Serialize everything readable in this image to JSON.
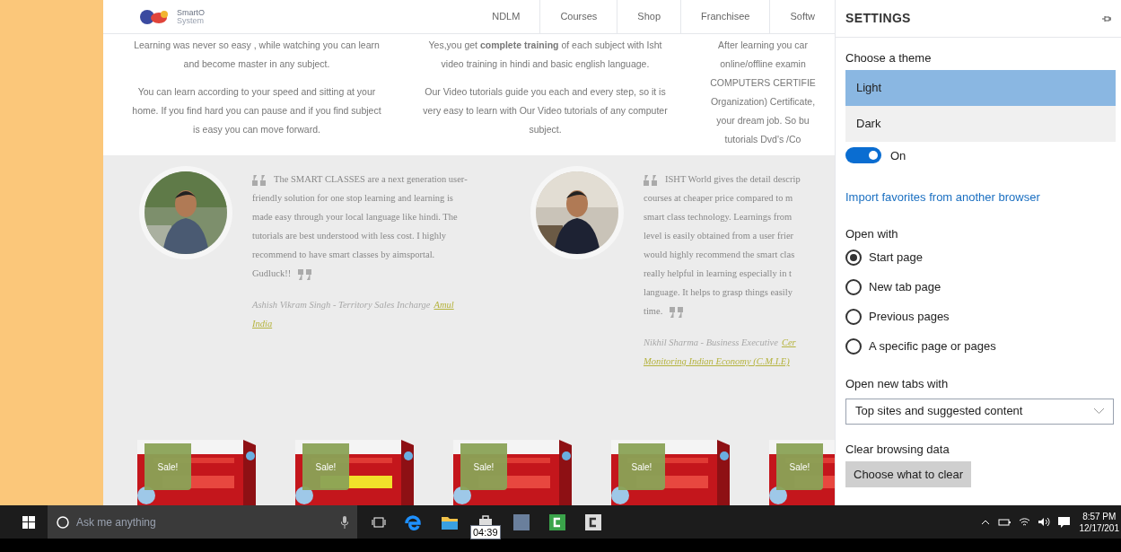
{
  "site": {
    "logo_text": "SmartO",
    "logo_sub": "System",
    "nav": [
      {
        "label": "NDLM"
      },
      {
        "label": "Courses"
      },
      {
        "label": "Shop"
      },
      {
        "label": "Franchisee"
      },
      {
        "label": "Softw"
      }
    ]
  },
  "features": [
    {
      "paragraphs": [
        [
          "Learning was never so easy , while watching you can learn",
          "and become master in any subject."
        ],
        [
          "You can learn according to your speed and sitting at your",
          "home. If you find hard you can pause and if you find subject",
          "is easy you can move forward."
        ]
      ]
    },
    {
      "paragraphs": [
        [
          "Yes,you get **complete training** of each subject with Isht",
          "video training in hindi and basic english language."
        ],
        [
          "Our Video tutorials guide you each and every step, so it is",
          "very easy to learn with Our Video tutorials of any computer",
          "subject."
        ]
      ]
    },
    {
      "paragraphs": [
        [
          "After learning you car",
          "online/offline examin",
          "COMPUTERS CERTIFIE",
          "Organization) Certificate,",
          "your dream job. So bu",
          "tutorials Dvd's /Co"
        ]
      ]
    }
  ],
  "testimonials": [
    {
      "lines": [
        "The SMART CLASSES are a next generation user-",
        "friendly solution for one stop learning and learning is",
        "made easy through your local language like hindi. The",
        "tutorials are best understood with less cost. I highly",
        "recommend to have smart classes by aimsportal.",
        "Gudluck!!"
      ],
      "author": "Ashish Vikram Singh - Territory Sales Incharge",
      "links": [
        "Amul",
        "India"
      ]
    },
    {
      "lines": [
        "ISHT World gives the detail descrip",
        "courses at cheaper price compared to m",
        "smart class technology. Learnings from",
        "level is easily obtained from a user frier",
        "would highly recommend the smart clas",
        "really helpful in learning especially in t",
        "language. It helps to grasp things easily",
        "time."
      ],
      "author": "Nikhil Sharma - Business Executive",
      "links": [
        "Cer",
        "Monitoring Indian Economy (C.M.I.E)"
      ]
    }
  ],
  "products": [
    {
      "badge": "Sale!"
    },
    {
      "badge": "Sale!"
    },
    {
      "badge": "Sale!"
    },
    {
      "badge": "Sale!"
    },
    {
      "badge": "Sale!"
    }
  ],
  "settings": {
    "title": "SETTINGS",
    "theme_label": "Choose a theme",
    "themes": [
      {
        "label": "Light",
        "selected": true
      },
      {
        "label": "Dark",
        "selected": false
      }
    ],
    "toggle": {
      "label": "On",
      "on": true
    },
    "import_link": "Import favorites from another browser",
    "open_with_label": "Open with",
    "open_with": [
      {
        "label": "Start page",
        "selected": true
      },
      {
        "label": "New tab page",
        "selected": false
      },
      {
        "label": "Previous pages",
        "selected": false
      },
      {
        "label": "A specific page or pages",
        "selected": false
      }
    ],
    "new_tabs_label": "Open new tabs with",
    "new_tabs_value": "Top sites and suggested content",
    "clear_label": "Clear browsing data",
    "clear_button": "Choose what to clear"
  },
  "taskbar": {
    "search_placeholder": "Ask me anything",
    "tooltip": "04:39",
    "time": "8:57 PM",
    "date": "12/17/201"
  }
}
